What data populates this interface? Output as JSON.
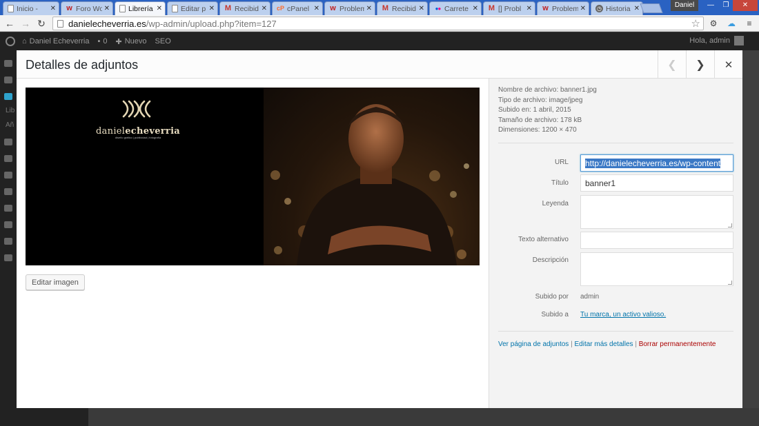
{
  "browser": {
    "tabs": [
      {
        "label": "Inicio -",
        "icon": "page"
      },
      {
        "label": "Foro Wo",
        "icon": "wu"
      },
      {
        "label": "Librería",
        "icon": "page",
        "active": true
      },
      {
        "label": "Editar p",
        "icon": "page"
      },
      {
        "label": "Recibid",
        "icon": "gmail"
      },
      {
        "label": "cPanel",
        "icon": "cpanel"
      },
      {
        "label": "Problem",
        "icon": "wu"
      },
      {
        "label": "Recibid",
        "icon": "gmail"
      },
      {
        "label": "Carrete",
        "icon": "flickr"
      },
      {
        "label": "[] Probl",
        "icon": "gmail"
      },
      {
        "label": "Problem",
        "icon": "wu"
      },
      {
        "label": "Historia",
        "icon": "history"
      }
    ],
    "profile_name": "Daniel",
    "url_host": "danielecheverria.es",
    "url_path": "/wp-admin/upload.php?item=127"
  },
  "wp_adminbar": {
    "site_name": "Daniel Echeverria",
    "comments_count": "0",
    "new_label": "Nuevo",
    "seo_label": "SEO",
    "greeting": "Hola, admin"
  },
  "sidebar_bg": {
    "label1": "Lib",
    "label2": "Añ"
  },
  "modal": {
    "title": "Detalles de adjuntos",
    "edit_image_label": "Editar imagen",
    "image": {
      "logo_name_light": "daniel",
      "logo_name_bold": "echeverria",
      "logo_tagline": "diseño gráfico | publicidad | fotografía"
    },
    "meta": {
      "filename": "Nombre de archivo: banner1.jpg",
      "filetype": "Tipo de archivo: image/jpeg",
      "uploaded_on": "Subido en: 1 abril, 2015",
      "filesize": "Tamaño de archivo: 178 kB",
      "dimensions": "Dimensiones: 1200 × 470"
    },
    "fields": {
      "url_label": "URL",
      "url_value": "http://danielecheverria.es/wp-content",
      "title_label": "Título",
      "title_value": "banner1",
      "caption_label": "Leyenda",
      "alt_label": "Texto alternativo",
      "description_label": "Descripción",
      "uploaded_by_label": "Subido por",
      "uploaded_by_value": "admin",
      "uploaded_to_label": "Subido a",
      "uploaded_to_value": "Tu marca, un activo valioso."
    },
    "actions": {
      "view_page": "Ver página de adjuntos",
      "edit_more": "Editar más detalles",
      "delete": "Borrar permanentemente",
      "separator": "|"
    }
  }
}
